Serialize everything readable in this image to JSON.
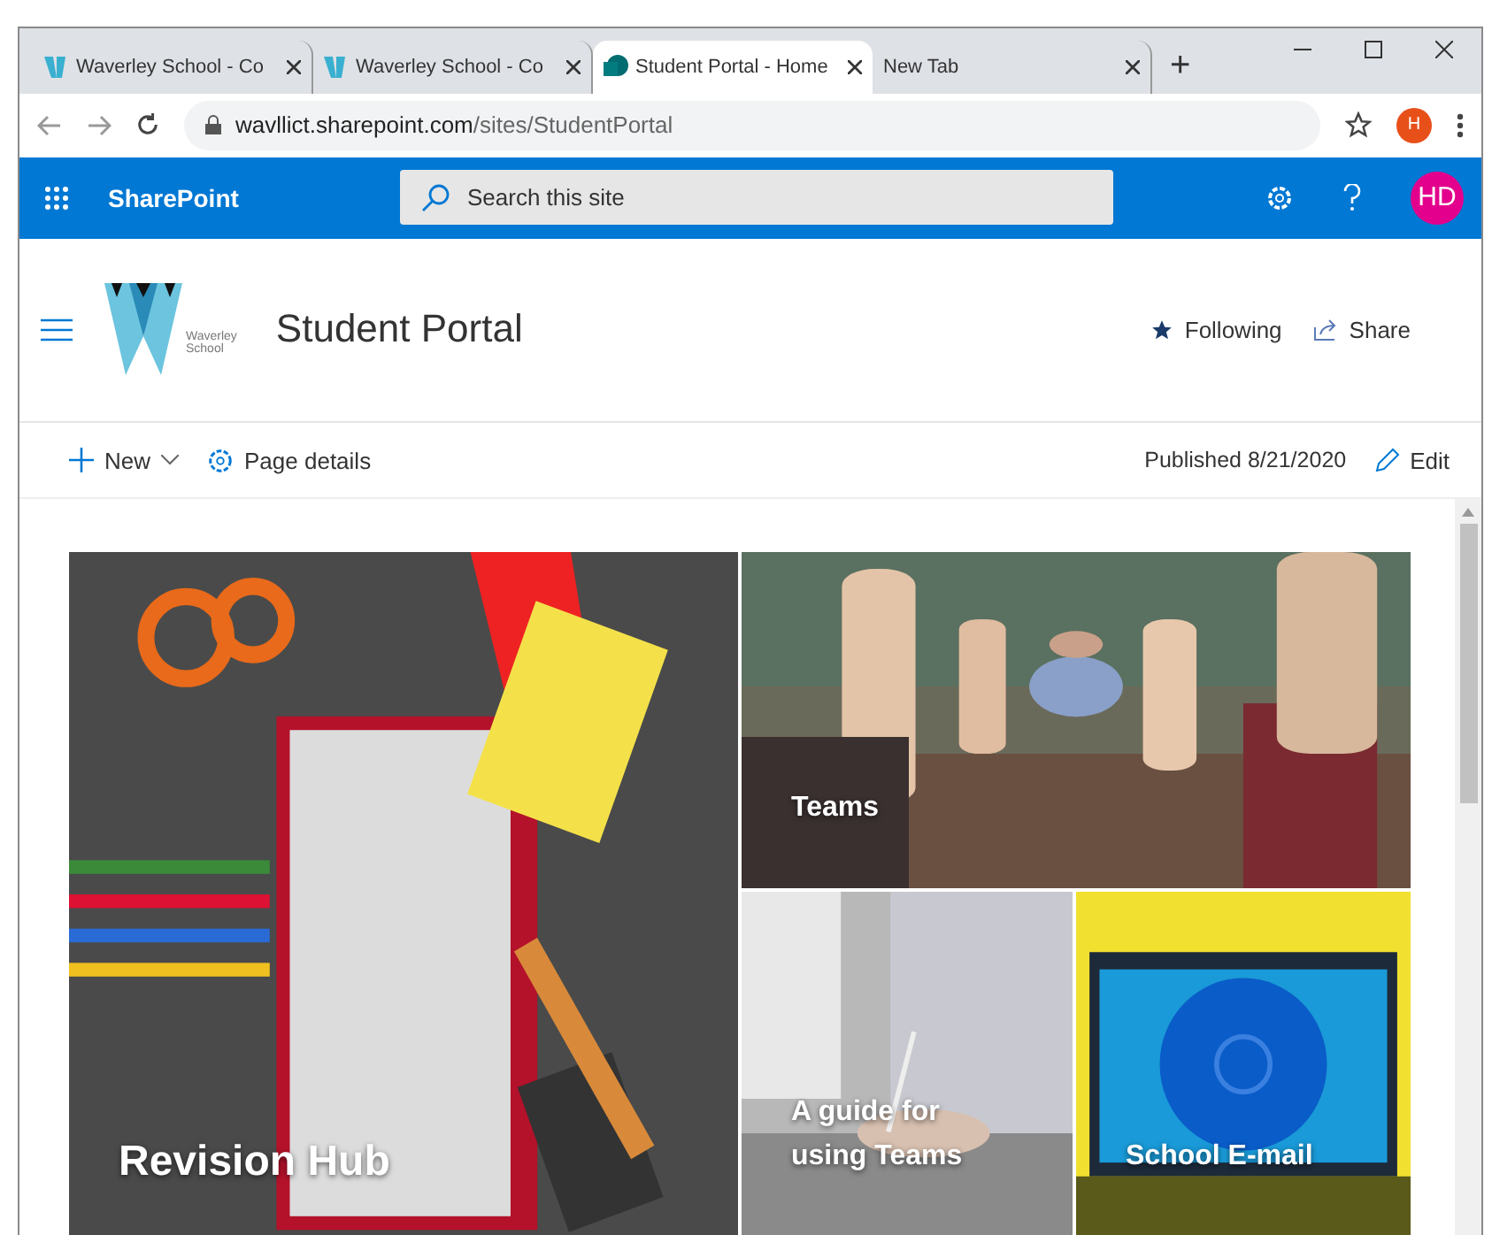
{
  "browser": {
    "tabs": [
      {
        "title": "Waverley School - Co",
        "kind": "school",
        "selected": false
      },
      {
        "title": "Waverley School - Co",
        "kind": "school",
        "selected": false
      },
      {
        "title": "Student Portal - Home",
        "kind": "sharepoint",
        "selected": true
      },
      {
        "title": "New Tab",
        "kind": "blank",
        "selected": false
      }
    ],
    "new_tab": "+",
    "url_host": "wavllict.sharepoint.com",
    "url_path": "/sites/StudentPortal",
    "profile": "H"
  },
  "suite_bar": {
    "app": "SharePoint",
    "search": {
      "placeholder": "Search this site"
    },
    "avatar": "HD"
  },
  "site_header": {
    "logo_lines": [
      "Waverley",
      "School"
    ],
    "title": "Student Portal",
    "actions": [
      "Following",
      "Share"
    ]
  },
  "command_bar": {
    "new": "New",
    "details": "Page details",
    "published": "Published 8/21/2020",
    "edit": "Edit"
  },
  "hero": [
    {
      "title": "Revision Hub",
      "kind": "desk"
    },
    {
      "title": "Teams",
      "kind": "classroom"
    },
    {
      "title": "A guide for using Teams",
      "kind": "writing"
    },
    {
      "title": "School E-mail",
      "kind": "laptop"
    }
  ]
}
